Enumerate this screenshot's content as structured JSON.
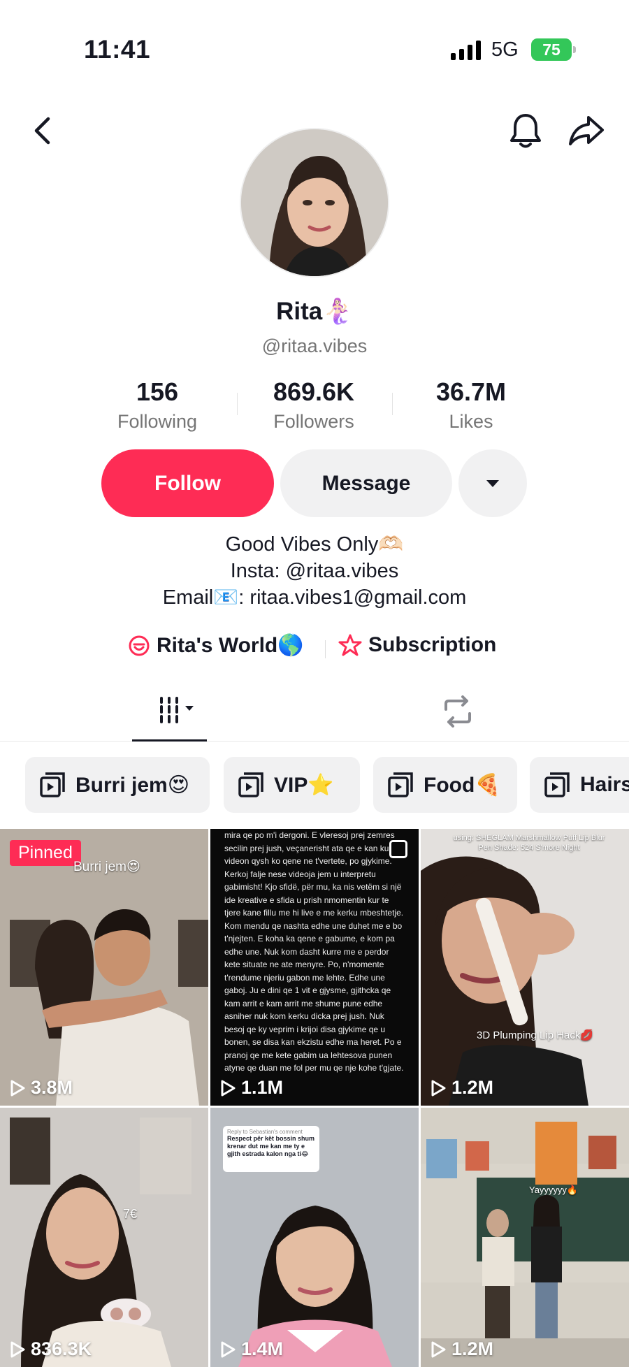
{
  "status_bar": {
    "time": "11:41",
    "network": "5G",
    "battery": "75"
  },
  "profile": {
    "name": "Rita🧜🏻‍♀️",
    "handle": "@ritaa.vibes",
    "stats": [
      {
        "value": "156",
        "label": "Following"
      },
      {
        "value": "869.6K",
        "label": "Followers"
      },
      {
        "value": "36.7M",
        "label": "Likes"
      }
    ],
    "buttons": {
      "follow": "Follow",
      "message": "Message"
    },
    "bio": [
      "Good Vibes Only🫶🏻",
      "Insta: @ritaa.vibes",
      "Email📧: ritaa.vibes1@gmail.com"
    ],
    "links": [
      {
        "label": "Rita's World🌎",
        "icon": "community-icon"
      },
      {
        "label": "Subscription",
        "icon": "subscription-star-icon"
      }
    ]
  },
  "tabs": {
    "videos_icon": "grid-icon",
    "repost_icon": "repost-icon"
  },
  "playlists": [
    {
      "label": "Burri jem😍"
    },
    {
      "label": "VIP⭐"
    },
    {
      "label": "Food🍕"
    },
    {
      "label": "Hairs"
    }
  ],
  "videos": [
    {
      "views": "3.8M",
      "pinned_label": "Pinned",
      "caption": "Burri jem😍"
    },
    {
      "views": "1.1M",
      "text": "mira qe po m'i dergoni. E vleresoj prej zemres secilin prej jush, veçanerisht ata qe e kan ku videon qysh ko qene ne t'vertete, po gjykime. Kerkoj falje nese videoja jem u interpretu gabimisht! Kjo sfidë, për mu, ka nis vetëm si një ide kreative e sfida u prish nmomentin kur te tjere kane fillu me hi live e me kerku mbeshtetje. Kom mendu qe nashta edhe une duhet me e bo t'njejten. E koha ka qene e gabume, e kom pa edhe une. Nuk kom dasht kurre me e perdor kete situate ne ate menyre. Po, n'momente t'rendume njeriu gabon me lehte. Edhe une gaboj. Ju e dini qe 1 vit e gjysme, gjithcka qe kam arrit e kam arrit me shume pune edhe asniher nuk kom kerku dicka prej jush. Nuk besoj qe ky veprim i krijoi disa gjykime qe u bonen, se disa kan ekzistu edhe ma heret. Po e pranoj qe me kete gabim ua lehtesova punen atyne qe duan me fol per mu qe nje kohe t'gjate."
    },
    {
      "views": "1.2M",
      "caption_top": "using: SHEGLAM Marshmallow Puff Lip Blur Pen Shade: 524 S'more Night",
      "caption": "3D Plumping Lip Hack💋"
    },
    {
      "views": "836.3K",
      "caption": "7€"
    },
    {
      "views": "1.4M",
      "reply_title": "Reply to Sebastian's comment",
      "reply": "Respect për kët bossin shum krenar dut me kan me ty e gjith estrada kalon nga ti😂"
    },
    {
      "views": "1.2M",
      "caption": "Yayyyyyy🔥"
    }
  ],
  "colors": {
    "accent": "#fe2c55",
    "button_gray": "#f1f1f2",
    "muted_text": "#757575",
    "battery": "#33c759"
  }
}
